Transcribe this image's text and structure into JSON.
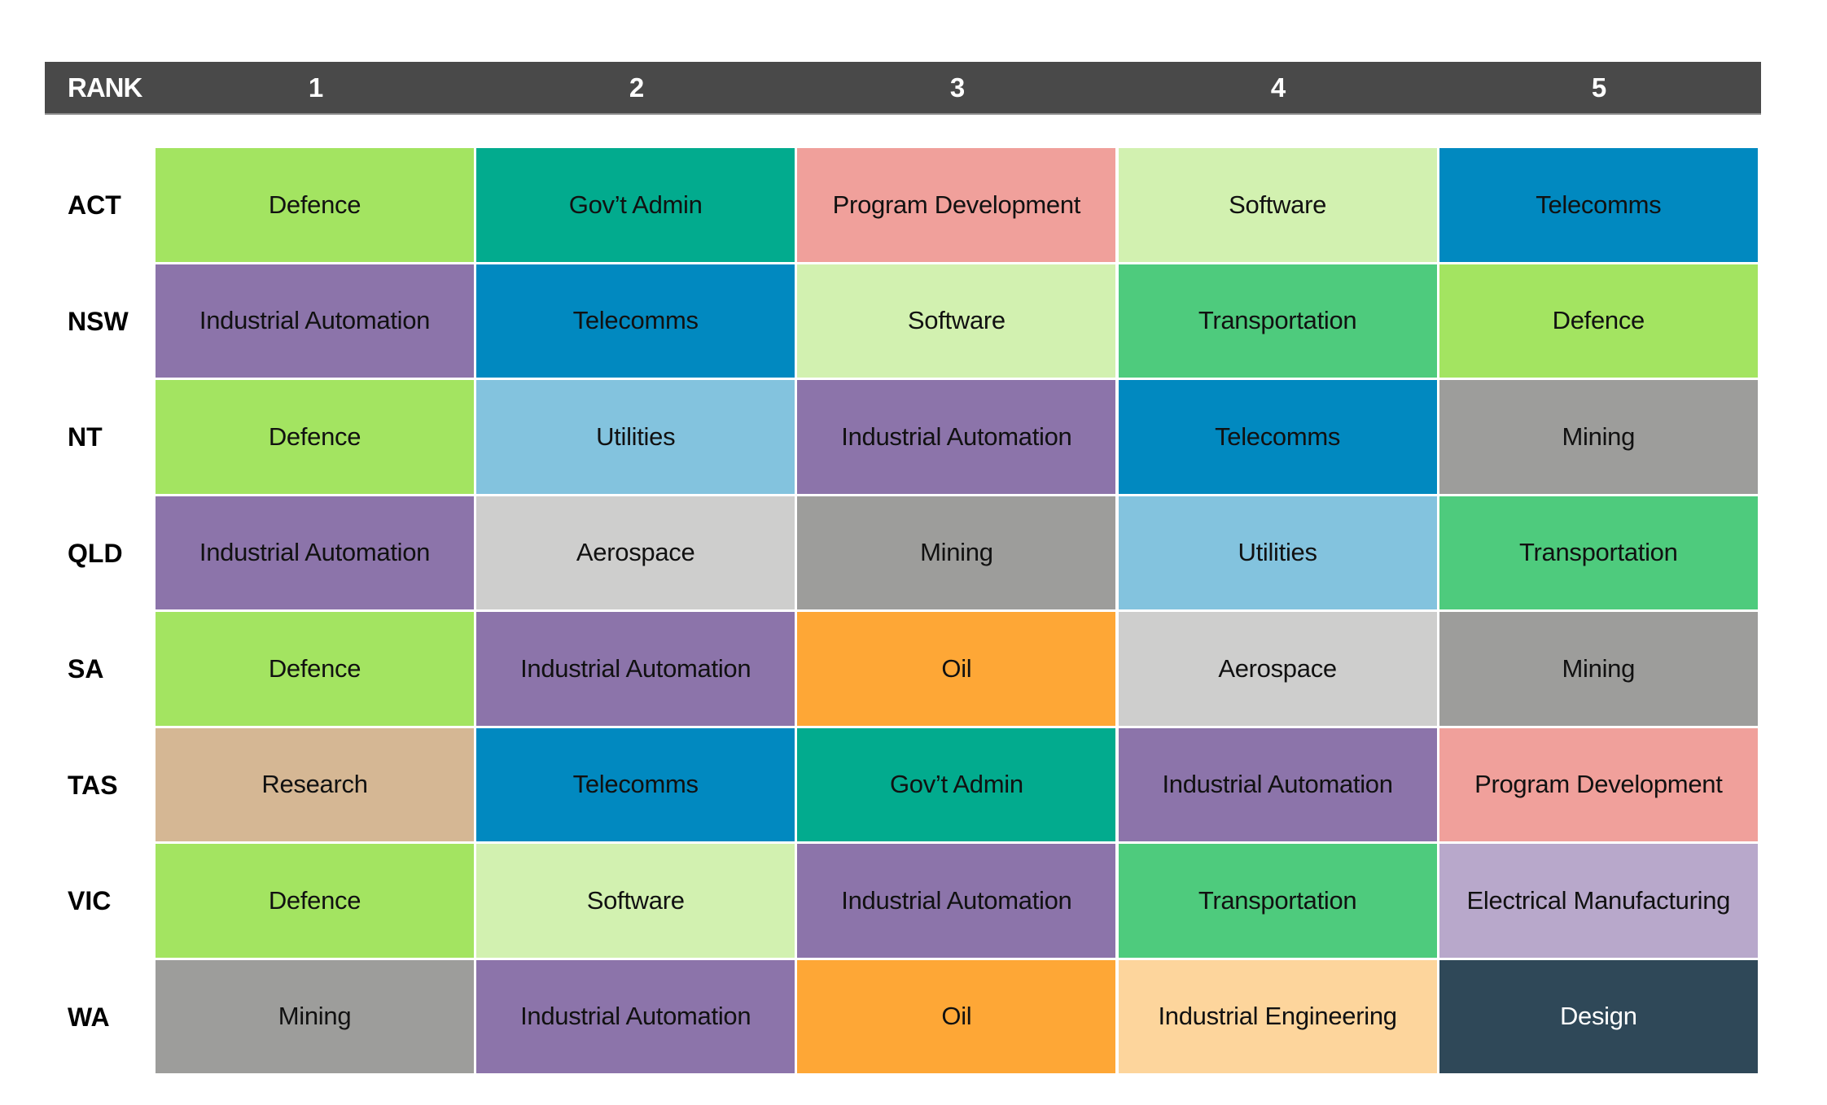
{
  "header": {
    "rank_label": "RANK",
    "ranks": [
      "1",
      "2",
      "3",
      "4",
      "5"
    ],
    "background": "#494949"
  },
  "industry_colors": {
    "Defence": "#a3e461",
    "Gov’t Admin": "#02ab8e",
    "Program Development": "#f0a09b",
    "Software": "#d2f1b0",
    "Telecomms": "#0189c0",
    "Industrial Automation": "#8c74aa",
    "Transportation": "#4ecb7d",
    "Utilities": "#83c3de",
    "Mining": "#9d9d9b",
    "Aerospace": "#cececd",
    "Oil": "#fea736",
    "Research": "#d5b794",
    "Electrical Manufacturing": "#b8a8cb",
    "Industrial Engineering": "#fdd59c",
    "Design": "#2f4858"
  },
  "light_text_industries": [
    "Design"
  ],
  "rows": [
    {
      "state": "ACT",
      "industries": [
        "Defence",
        "Gov’t Admin",
        "Program Development",
        "Software",
        "Telecomms"
      ]
    },
    {
      "state": "NSW",
      "industries": [
        "Industrial Automation",
        "Telecomms",
        "Software",
        "Transportation",
        "Defence"
      ]
    },
    {
      "state": "NT",
      "industries": [
        "Defence",
        "Utilities",
        "Industrial Automation",
        "Telecomms",
        "Mining"
      ]
    },
    {
      "state": "QLD",
      "industries": [
        "Industrial Automation",
        "Aerospace",
        "Mining",
        "Utilities",
        "Transportation"
      ]
    },
    {
      "state": "SA",
      "industries": [
        "Defence",
        "Industrial Automation",
        "Oil",
        "Aerospace",
        "Mining"
      ]
    },
    {
      "state": "TAS",
      "industries": [
        "Research",
        "Telecomms",
        "Gov’t Admin",
        "Industrial Automation",
        "Program Development"
      ]
    },
    {
      "state": "VIC",
      "industries": [
        "Defence",
        "Software",
        "Industrial Automation",
        "Transportation",
        "Electrical Manufacturing"
      ]
    },
    {
      "state": "WA",
      "industries": [
        "Mining",
        "Industrial Automation",
        "Oil",
        "Industrial Engineering",
        "Design"
      ]
    }
  ]
}
